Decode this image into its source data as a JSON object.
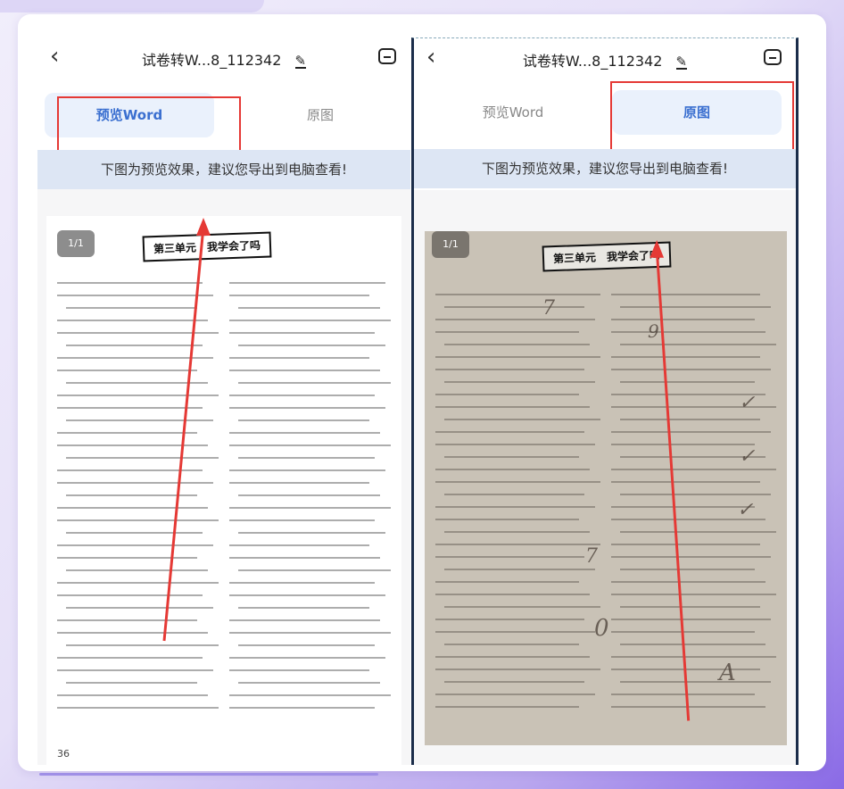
{
  "panels": [
    {
      "title": "试卷转W...8_112342",
      "tabs": [
        {
          "label": "预览Word",
          "active": true
        },
        {
          "label": "原图",
          "active": false
        }
      ],
      "banner": "下图为预览效果，建议您导出到电脑查看!",
      "page_indicator": "1/1",
      "unit_title": "第三单元　我学会了吗",
      "page_number": "36"
    },
    {
      "title": "试卷转W...8_112342",
      "tabs": [
        {
          "label": "预览Word",
          "active": false
        },
        {
          "label": "原图",
          "active": true
        }
      ],
      "banner": "下图为预览效果，建议您导出到电脑查看!",
      "page_indicator": "1/1",
      "unit_title": "第三单元　我学会了吗"
    }
  ],
  "annotations": {
    "highlight_color": "#e53935",
    "arrow_color": "#e53935"
  },
  "icons": {
    "back": "chevron-left-icon",
    "edit": "pencil-icon",
    "save": "save-icon"
  }
}
